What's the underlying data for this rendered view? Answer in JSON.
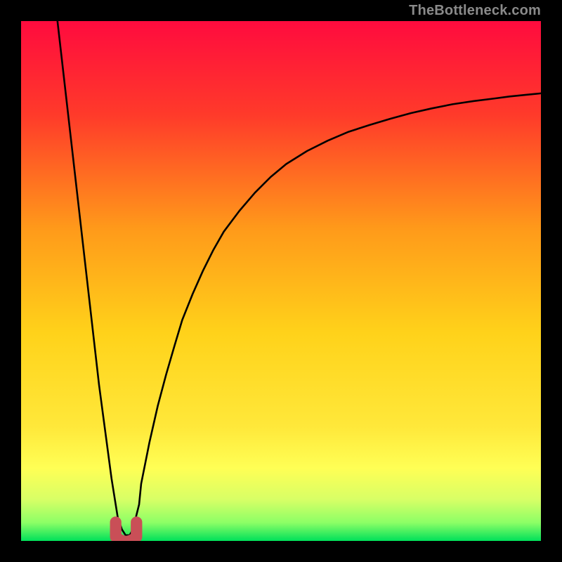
{
  "watermark": "TheBottleneck.com",
  "colors": {
    "frame_bg": "#000000",
    "grad_top": "#ff0b3e",
    "grad_mid1": "#ff6a1a",
    "grad_mid2": "#ffd21a",
    "grad_low1": "#ffff55",
    "grad_low2": "#d8ff66",
    "grad_bottom": "#00e05a",
    "curve_stroke": "#000000",
    "marker_fill": "#c94f57",
    "marker_stroke": "#c94f57"
  },
  "chart_data": {
    "type": "line",
    "title": "",
    "xlabel": "",
    "ylabel": "",
    "xlim": [
      0,
      100
    ],
    "ylim": [
      0,
      100
    ],
    "x": [
      7.0,
      7.8,
      8.6,
      9.4,
      10.2,
      11.0,
      11.8,
      12.6,
      13.4,
      14.2,
      15.0,
      15.8,
      16.6,
      17.4,
      18.2,
      18.6,
      19.4,
      20.1,
      20.9,
      21.5,
      22.7,
      23.1,
      24.7,
      26.3,
      27.9,
      29.5,
      31.0,
      33.0,
      35.0,
      37.0,
      39.0,
      42.0,
      45.0,
      48.0,
      51.0,
      55.0,
      59.0,
      63.0,
      67.0,
      71.0,
      75.0,
      79.0,
      83.0,
      87.0,
      91.0,
      94.0,
      97.0,
      100.0
    ],
    "values": [
      100.0,
      93.0,
      86.0,
      79.0,
      72.0,
      65.0,
      58.0,
      51.0,
      44.0,
      37.0,
      30.0,
      24.0,
      18.0,
      12.0,
      7.0,
      4.5,
      2.2,
      1.1,
      1.1,
      2.2,
      7.0,
      11.0,
      19.0,
      26.0,
      32.0,
      37.5,
      42.5,
      47.5,
      52.0,
      56.0,
      59.5,
      63.5,
      67.0,
      70.0,
      72.5,
      75.0,
      77.0,
      78.7,
      80.0,
      81.2,
      82.3,
      83.2,
      84.0,
      84.6,
      85.1,
      85.5,
      85.8,
      86.1
    ],
    "marker": {
      "shape": "u",
      "cx": 20.2,
      "cy": 1.6,
      "width": 4.0,
      "height": 4.0
    },
    "gradient_stops": [
      {
        "offset": 0.0,
        "color": "#ff0b3e"
      },
      {
        "offset": 0.18,
        "color": "#ff3a2a"
      },
      {
        "offset": 0.4,
        "color": "#ff9a1a"
      },
      {
        "offset": 0.6,
        "color": "#ffd21a"
      },
      {
        "offset": 0.78,
        "color": "#ffe83a"
      },
      {
        "offset": 0.86,
        "color": "#ffff55"
      },
      {
        "offset": 0.92,
        "color": "#d8ff66"
      },
      {
        "offset": 0.965,
        "color": "#8cff66"
      },
      {
        "offset": 1.0,
        "color": "#00e05a"
      }
    ]
  }
}
